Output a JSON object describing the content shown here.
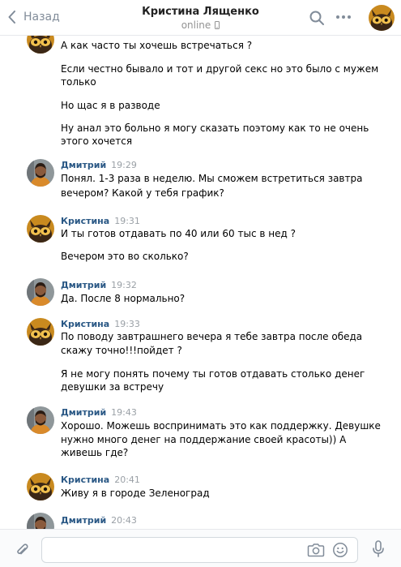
{
  "header": {
    "back_label": "Назад",
    "contact_name": "Кристина Лященко",
    "status": "online"
  },
  "messages": [
    {
      "author": "",
      "time": "",
      "lines": [
        "А как часто ты хочешь встречаться ?",
        "Если честно бывало и тот и другой секс но это было с мужем",
        "только",
        "Но щас я в разводе",
        "Ну анал это больно я могу сказать поэтому как то не очень",
        "этого хочется"
      ]
    },
    {
      "author": "Дмитрий",
      "time": "19:29",
      "lines": [
        "Понял. 1-3 раза в неделю. Мы сможем встретиться завтра",
        "вечером? Какой у тебя график?"
      ]
    },
    {
      "author": "Кристина",
      "time": "19:31",
      "lines": [
        "И ты готов отдавать по 40 или 60 тыс в нед ?",
        "Вечером это во сколько?"
      ]
    },
    {
      "author": "Дмитрий",
      "time": "19:32",
      "lines": [
        "Да. После 8 нормально?"
      ]
    },
    {
      "author": "Кристина",
      "time": "19:33",
      "lines": [
        "По поводу завтрашнего вечера я тебе завтра после обеда",
        "скажу точно!!!пойдет ?",
        "Я не могу понять почему ты готов отдавать столько денег",
        "девушки за встречу"
      ]
    },
    {
      "author": "Дмитрий",
      "time": "19:43",
      "lines": [
        "Хорошо. Можешь воспринимать это как поддержку. Девушке",
        "нужно много денег на поддержание своей красоты)) А",
        "живешь где?"
      ]
    },
    {
      "author": "Кристина",
      "time": "20:41",
      "lines": [
        "Живу я в городе Зеленоград"
      ]
    },
    {
      "author": "Дмитрий",
      "time": "20:43",
      "lines": []
    }
  ],
  "icons": {
    "back": "chevron-left-icon",
    "mobile": "mobile-phone-icon",
    "search": "search-icon",
    "more": "more-horizontal-icon",
    "attach": "paperclip-icon",
    "camera": "camera-icon",
    "emoji": "smile-icon",
    "voice": "microphone-icon"
  },
  "colors": {
    "author": "#2a5885",
    "time": "#9aa0a6",
    "icon": "#818c99"
  }
}
